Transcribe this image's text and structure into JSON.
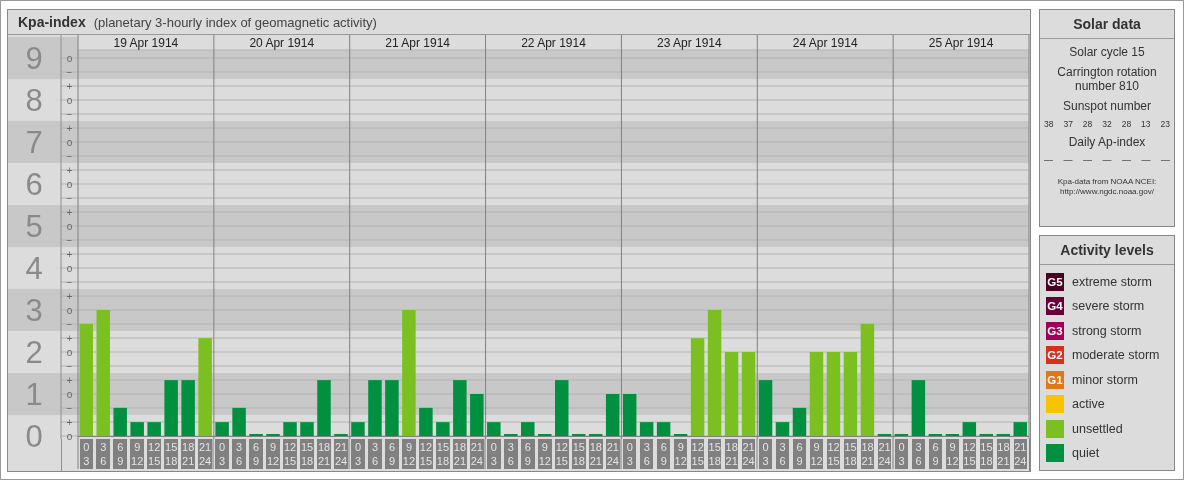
{
  "kp_panel": {
    "title": "Kpa-index",
    "subtitle": "(planetary 3-hourly index of geomagnetic activity)",
    "sub_ticks": [
      "o",
      "−",
      "+",
      "o",
      "−",
      "+",
      "o",
      "−",
      "+",
      "o",
      "−",
      "+",
      "o",
      "−",
      "+",
      "o",
      "−",
      "+",
      "o",
      "−",
      "+",
      "o",
      "−",
      "+",
      "o",
      "−",
      "+",
      "o"
    ],
    "days": [
      {
        "date": "19 Apr 1914"
      },
      {
        "date": "20 Apr 1914"
      },
      {
        "date": "21 Apr 1914"
      },
      {
        "date": "22 Apr 1914"
      },
      {
        "date": "23 Apr 1914"
      },
      {
        "date": "24 Apr 1914"
      },
      {
        "date": "25 Apr 1914"
      }
    ],
    "chart_data": {
      "type": "bar",
      "grid": true,
      "ylim": [
        0,
        9
      ],
      "yticks": [
        {
          "value": 9,
          "label": "9"
        },
        {
          "value": 8,
          "label": "8"
        },
        {
          "value": 7,
          "label": "7"
        },
        {
          "value": 6,
          "label": "6"
        },
        {
          "value": 5,
          "label": "5"
        },
        {
          "value": 4,
          "label": "4"
        },
        {
          "value": 3,
          "label": "3"
        },
        {
          "value": 2,
          "label": "2"
        },
        {
          "value": 1,
          "label": "1"
        },
        {
          "value": 0,
          "label": "0"
        }
      ],
      "categories": [
        "0 3",
        "3 6",
        "6 9",
        "9 12",
        "12 15",
        "15 18",
        "18 21",
        "21 24",
        "0 3",
        "3 6",
        "6 9",
        "9 12",
        "12 15",
        "15 18",
        "18 21",
        "21 24",
        "0 3",
        "3 6",
        "6 9",
        "9 12",
        "12 15",
        "15 18",
        "18 21",
        "21 24",
        "0 3",
        "3 6",
        "6 9",
        "9 12",
        "12 15",
        "15 18",
        "18 21",
        "21 24",
        "0 3",
        "3 6",
        "6 9",
        "9 12",
        "12 15",
        "15 18",
        "18 21",
        "21 24",
        "0 3",
        "3 6",
        "6 9",
        "9 12",
        "12 15",
        "15 18",
        "18 21",
        "21 24",
        "0 3",
        "3 6",
        "6 9",
        "9 12",
        "12 15",
        "15 18",
        "18 21",
        "21 24"
      ],
      "series": [
        {
          "color": "#009040",
          "values": [
            null,
            null,
            0.67,
            0.33,
            0.33,
            1.33,
            1.33,
            null,
            0.33,
            0.67,
            0,
            0,
            0.33,
            0.33,
            1.33,
            0,
            0.33,
            1.33,
            1.33,
            null,
            0.67,
            0.33,
            1.33,
            1,
            0.33,
            0,
            0.33,
            0,
            1.33,
            0,
            0,
            1,
            1,
            0.33,
            0.33,
            0,
            null,
            null,
            null,
            null,
            1.33,
            0.33,
            0.67,
            null,
            null,
            null,
            null,
            0,
            0,
            1.33,
            0,
            0,
            0.33,
            0,
            0,
            0.33
          ]
        },
        {
          "color": "#7bc020",
          "values": [
            2.67,
            3,
            null,
            null,
            null,
            null,
            null,
            2.33,
            null,
            null,
            null,
            null,
            null,
            null,
            null,
            null,
            null,
            null,
            null,
            3,
            null,
            null,
            null,
            null,
            null,
            null,
            null,
            null,
            null,
            null,
            null,
            null,
            null,
            null,
            null,
            null,
            2.33,
            3,
            2,
            2,
            null,
            null,
            null,
            2,
            2,
            2,
            2.67,
            null,
            null,
            null,
            null,
            null,
            null,
            null,
            null,
            null
          ]
        }
      ]
    }
  },
  "solar_data": {
    "title": "Solar data",
    "solar_cycle": "Solar cycle 15",
    "carrington": "Carrington rotation number 810",
    "sunspot_title": "Sunspot number",
    "sunspot_numbers": [
      "38",
      "37",
      "28",
      "32",
      "28",
      "13",
      "23"
    ],
    "ap_title": "Daily Ap-index",
    "ap_values": [
      "—",
      "—",
      "—",
      "—",
      "—",
      "—",
      "—"
    ],
    "credit_line_1": "Kpa-data from NOAA NCEI:",
    "credit_line_2": "http://www.ngdc.noaa.gov/"
  },
  "activity_levels": {
    "title": "Activity levels",
    "items": [
      {
        "badge": "G5",
        "label": "extreme storm",
        "color": "#4a0020"
      },
      {
        "badge": "G4",
        "label": "severe storm",
        "color": "#660038"
      },
      {
        "badge": "G3",
        "label": "strong storm",
        "color": "#a00058"
      },
      {
        "badge": "G2",
        "label": "moderate storm",
        "color": "#d8301c"
      },
      {
        "badge": "G1",
        "label": "minor storm",
        "color": "#e07818"
      },
      {
        "label": "active",
        "color": "#f8c400"
      },
      {
        "label": "unsettled",
        "color": "#7bc020"
      },
      {
        "label": "quiet",
        "color": "#009040"
      }
    ]
  }
}
